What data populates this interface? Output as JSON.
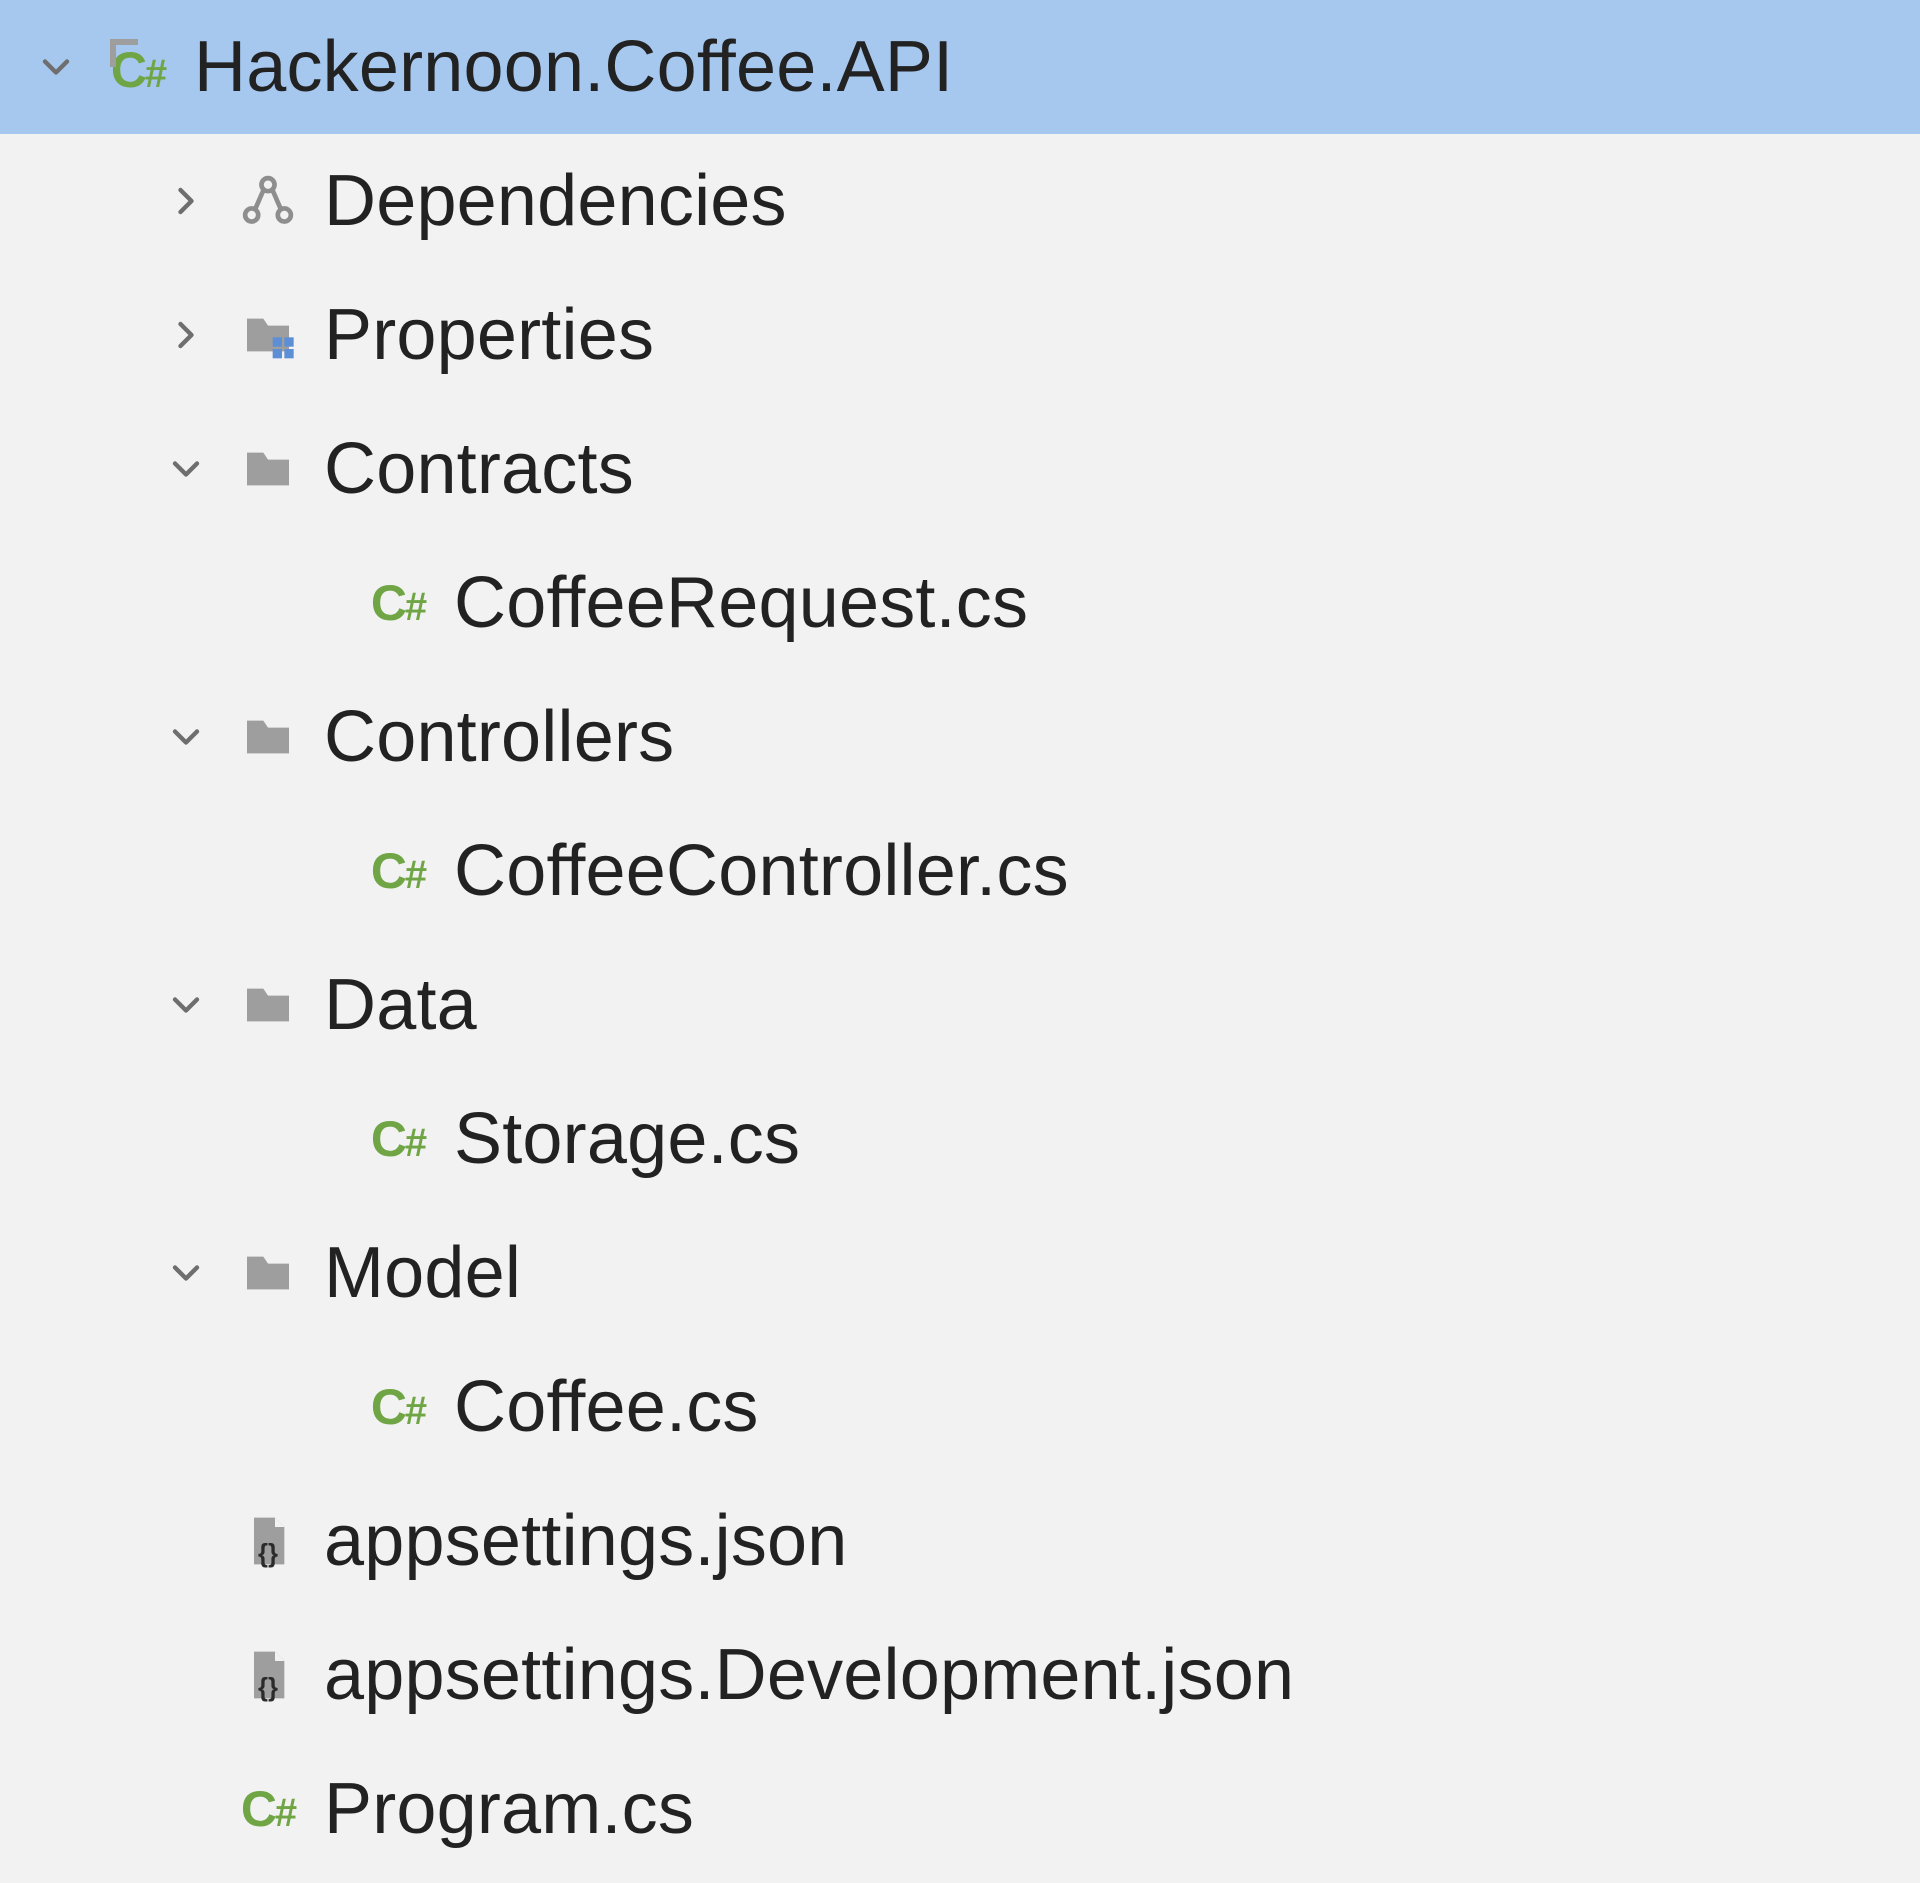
{
  "tree": {
    "root_label": "Hackernoon.Coffee.API",
    "dependencies_label": "Dependencies",
    "properties_label": "Properties",
    "contracts_label": "Contracts",
    "contracts_file_1": "CoffeeRequest.cs",
    "controllers_label": "Controllers",
    "controllers_file_1": "CoffeeController.cs",
    "data_label": "Data",
    "data_file_1": "Storage.cs",
    "model_label": "Model",
    "model_file_1": "Coffee.cs",
    "appsettings_label": "appsettings.json",
    "appsettings_dev_label": "appsettings.Development.json",
    "program_label": "Program.cs"
  },
  "colors": {
    "selection": "#a6c7ee",
    "csharp_green": "#6fa544",
    "folder_grey": "#9e9e9e",
    "background": "#f2f2f2"
  }
}
